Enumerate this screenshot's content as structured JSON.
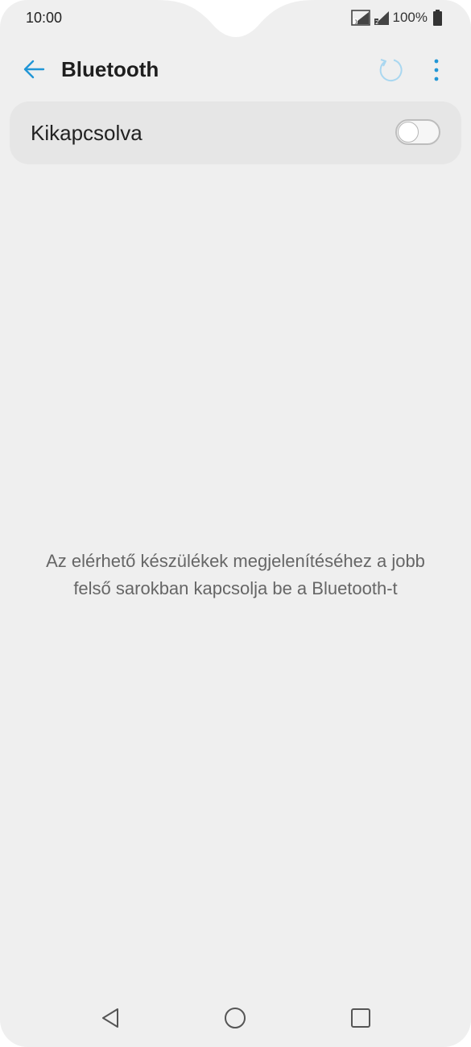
{
  "status_bar": {
    "time": "10:00",
    "battery_percent": "100%",
    "icons": [
      "signal-sim1-icon",
      "signal-sim2-icon",
      "battery-full-icon"
    ]
  },
  "app_bar": {
    "title": "Bluetooth",
    "back_icon": "arrow-left-icon",
    "refresh_icon": "refresh-icon",
    "more_icon": "more-vertical-icon"
  },
  "bluetooth_toggle": {
    "label": "Kikapcsolva",
    "enabled": false
  },
  "info": {
    "message": "Az elérhető készülékek megjelenítéséhez a jobb felső sarokban kapcsolja be a Bluetooth-t"
  },
  "nav_bar": {
    "icons": [
      "nav-back-icon",
      "nav-home-icon",
      "nav-recents-icon"
    ]
  },
  "colors": {
    "accent": "#2196d6",
    "background": "#efefef",
    "card": "#e6e6e6"
  }
}
